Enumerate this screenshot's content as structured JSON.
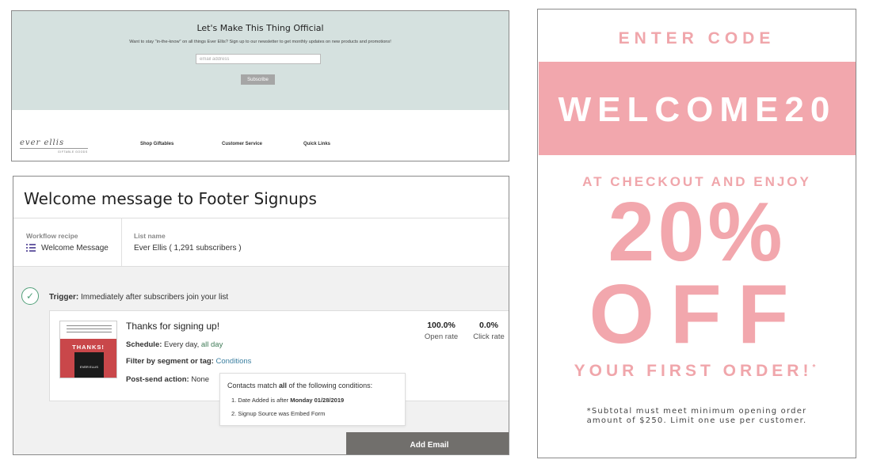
{
  "newsletter": {
    "title": "Let's Make This Thing Official",
    "subtitle": "Want to stay \"in-the-know\" on all things Ever Ellis? Sign up to our newsletter to get monthly updates on new products and promotions!",
    "email_placeholder": "email address",
    "subscribe_label": "Subscribe",
    "background_color": "#d5e1df"
  },
  "footer": {
    "logo_script": "ever ellis",
    "logo_tagline": "GIFTABLE GOODS",
    "links": [
      "Shop Giftables",
      "Customer Service",
      "Quick Links"
    ]
  },
  "workflow": {
    "title": "Welcome message to Footer Signups",
    "recipe_label": "Workflow recipe",
    "recipe_icon": "list-icon",
    "recipe_value": "Welcome Message",
    "list_label": "List name",
    "list_value": "Ever Ellis ( 1,291 subscribers )",
    "trigger_label": "Trigger:",
    "trigger_text": " Immediately after subscribers join your list",
    "email": {
      "name": "Thanks for signing up!",
      "thumb_word": "THANKS!",
      "thumb_card_text": "EVER ELLIS",
      "schedule_label": "Schedule:",
      "schedule_value": " Every day, ",
      "schedule_green": "all day",
      "filter_label": "Filter by segment or tag: ",
      "filter_link": "Conditions",
      "post_send_label": "Post-send action:",
      "post_send_value": " None",
      "open_rate_value": "100.0%",
      "open_rate_label": "Open rate",
      "click_rate_value": "0.0%",
      "click_rate_label": "Click rate"
    },
    "conditions": {
      "head_pre": "Contacts match ",
      "head_bold": "all",
      "head_post": " of the following conditions:",
      "item1_pre": "1. Date Added is after ",
      "item1_bold": "Monday 01/28/2019",
      "item2": "2. Signup Source was Embed Form"
    },
    "add_email_label": "Add Email",
    "accent_green": "#52a07a",
    "button_color": "#716f6c"
  },
  "promo": {
    "enter": "ENTER CODE",
    "code": "WELCOME20",
    "checkout": "AT CHECKOUT AND ENJOY",
    "percent": "20%",
    "off": "OFF",
    "first": "YOUR FIRST ORDER!",
    "asterisk": "*",
    "fine1": "*Subtotal must meet minimum opening order",
    "fine2": "amount of $250. Limit one use per customer.",
    "pink": "#f2a7ad"
  }
}
